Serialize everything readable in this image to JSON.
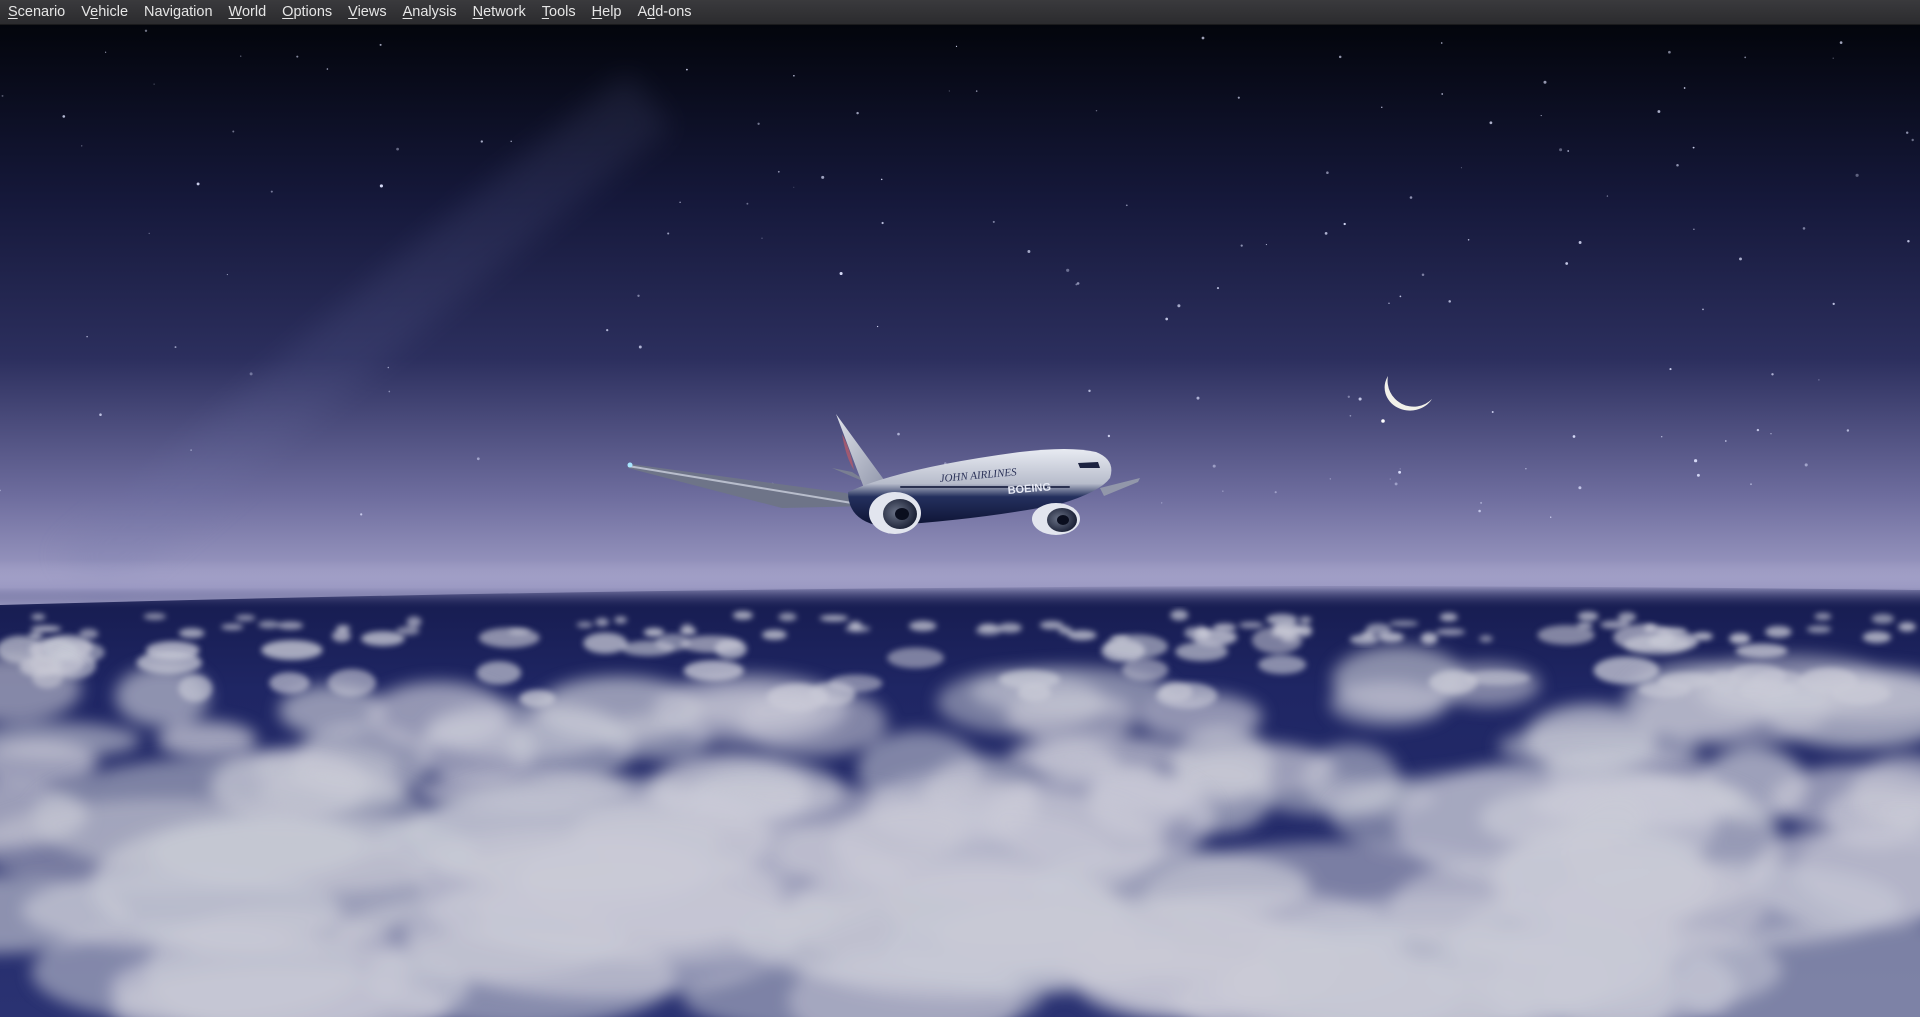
{
  "app": {
    "menu": [
      {
        "pre": "",
        "mn": "S",
        "post": "cenario"
      },
      {
        "pre": "V",
        "mn": "e",
        "post": "hicle"
      },
      {
        "pre": "Navigation",
        "mn": "",
        "post": ""
      },
      {
        "pre": "",
        "mn": "W",
        "post": "orld"
      },
      {
        "pre": "",
        "mn": "O",
        "post": "ptions"
      },
      {
        "pre": "",
        "mn": "V",
        "post": "iews"
      },
      {
        "pre": "",
        "mn": "A",
        "post": "nalysis"
      },
      {
        "pre": "",
        "mn": "N",
        "post": "etwork"
      },
      {
        "pre": "",
        "mn": "T",
        "post": "ools"
      },
      {
        "pre": "",
        "mn": "H",
        "post": "elp"
      },
      {
        "pre": "A",
        "mn": "d",
        "post": "d-ons"
      }
    ]
  },
  "scene": {
    "sky_top": "#03050c",
    "sky_mid": "#2c2f5e",
    "sky_horizon": "#a8a6cc",
    "ocean": "#1f2664",
    "cloud": "#c9cad6",
    "moon": "#f2f1ea",
    "aircraft": {
      "fuselage_text": "JOHN AIRLINES",
      "engine_text": "BOEING"
    }
  }
}
